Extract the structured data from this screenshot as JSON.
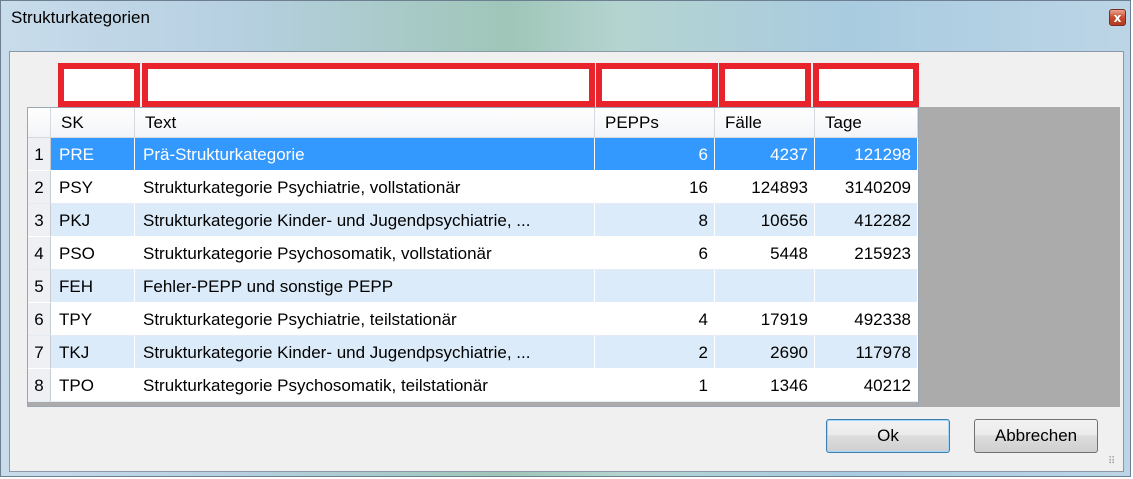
{
  "window": {
    "title": "Strukturkategorien",
    "close_icon": "close-icon"
  },
  "grid": {
    "columns": [
      "SK",
      "Text",
      "PEPPs",
      "Fälle",
      "Tage"
    ],
    "rows": [
      {
        "n": "1",
        "sk": "PRE",
        "text": "Prä-Strukturkategorie",
        "pepps": "6",
        "faelle": "4237",
        "tage": "121298"
      },
      {
        "n": "2",
        "sk": "PSY",
        "text": "Strukturkategorie Psychiatrie, vollstationär",
        "pepps": "16",
        "faelle": "124893",
        "tage": "3140209"
      },
      {
        "n": "3",
        "sk": "PKJ",
        "text": "Strukturkategorie Kinder- und Jugendpsychiatrie, ...",
        "pepps": "8",
        "faelle": "10656",
        "tage": "412282"
      },
      {
        "n": "4",
        "sk": "PSO",
        "text": "Strukturkategorie Psychosomatik, vollstationär",
        "pepps": "6",
        "faelle": "5448",
        "tage": "215923"
      },
      {
        "n": "5",
        "sk": "FEH",
        "text": "Fehler-PEPP und sonstige PEPP",
        "pepps": "",
        "faelle": "",
        "tage": ""
      },
      {
        "n": "6",
        "sk": "TPY",
        "text": "Strukturkategorie Psychiatrie, teilstationär",
        "pepps": "4",
        "faelle": "17919",
        "tage": "492338"
      },
      {
        "n": "7",
        "sk": "TKJ",
        "text": "Strukturkategorie Kinder- und Jugendpsychiatrie, ...",
        "pepps": "2",
        "faelle": "2690",
        "tage": "117978"
      },
      {
        "n": "8",
        "sk": "TPO",
        "text": "Strukturkategorie Psychosomatik, teilstationär",
        "pepps": "1",
        "faelle": "1346",
        "tage": "40212"
      }
    ],
    "selected_row": 1
  },
  "buttons": {
    "ok": "Ok",
    "cancel": "Abbrechen"
  },
  "colors": {
    "selection": "#3399ff",
    "row_alt": "#dcebf9",
    "highlight_box": "#e8232c"
  }
}
